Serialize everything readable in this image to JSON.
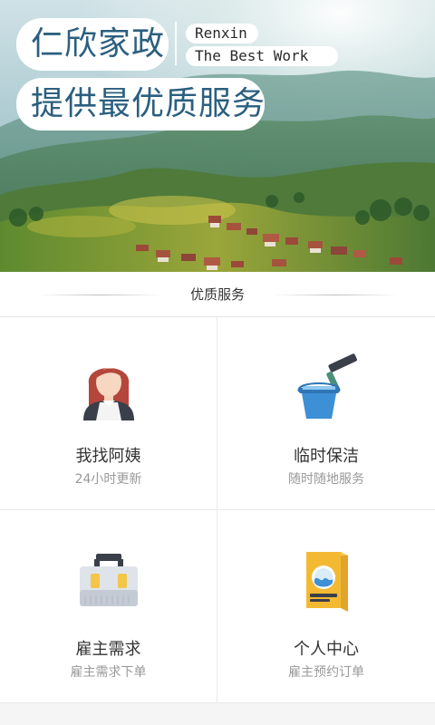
{
  "hero": {
    "title_line1": "仁欣家政",
    "title_line2": "提供最优质服务",
    "brand_en": "Renxin",
    "tagline_en": "The Best Work"
  },
  "section": {
    "title": "优质服务"
  },
  "services": [
    {
      "label": "我找阿姨",
      "sub": "24小时更新",
      "icon": "housekeeper-icon"
    },
    {
      "label": "临时保洁",
      "sub": "随时随地服务",
      "icon": "cleaning-bucket-icon"
    },
    {
      "label": "雇主需求",
      "sub": "雇主需求下单",
      "icon": "toolbox-icon"
    },
    {
      "label": "个人中心",
      "sub": "雇主预约订单",
      "icon": "detergent-box-icon"
    }
  ],
  "colors": {
    "brand_text": "#2b5f7f",
    "label": "#333333",
    "sub": "#999999",
    "divider": "#e9e9e9"
  }
}
